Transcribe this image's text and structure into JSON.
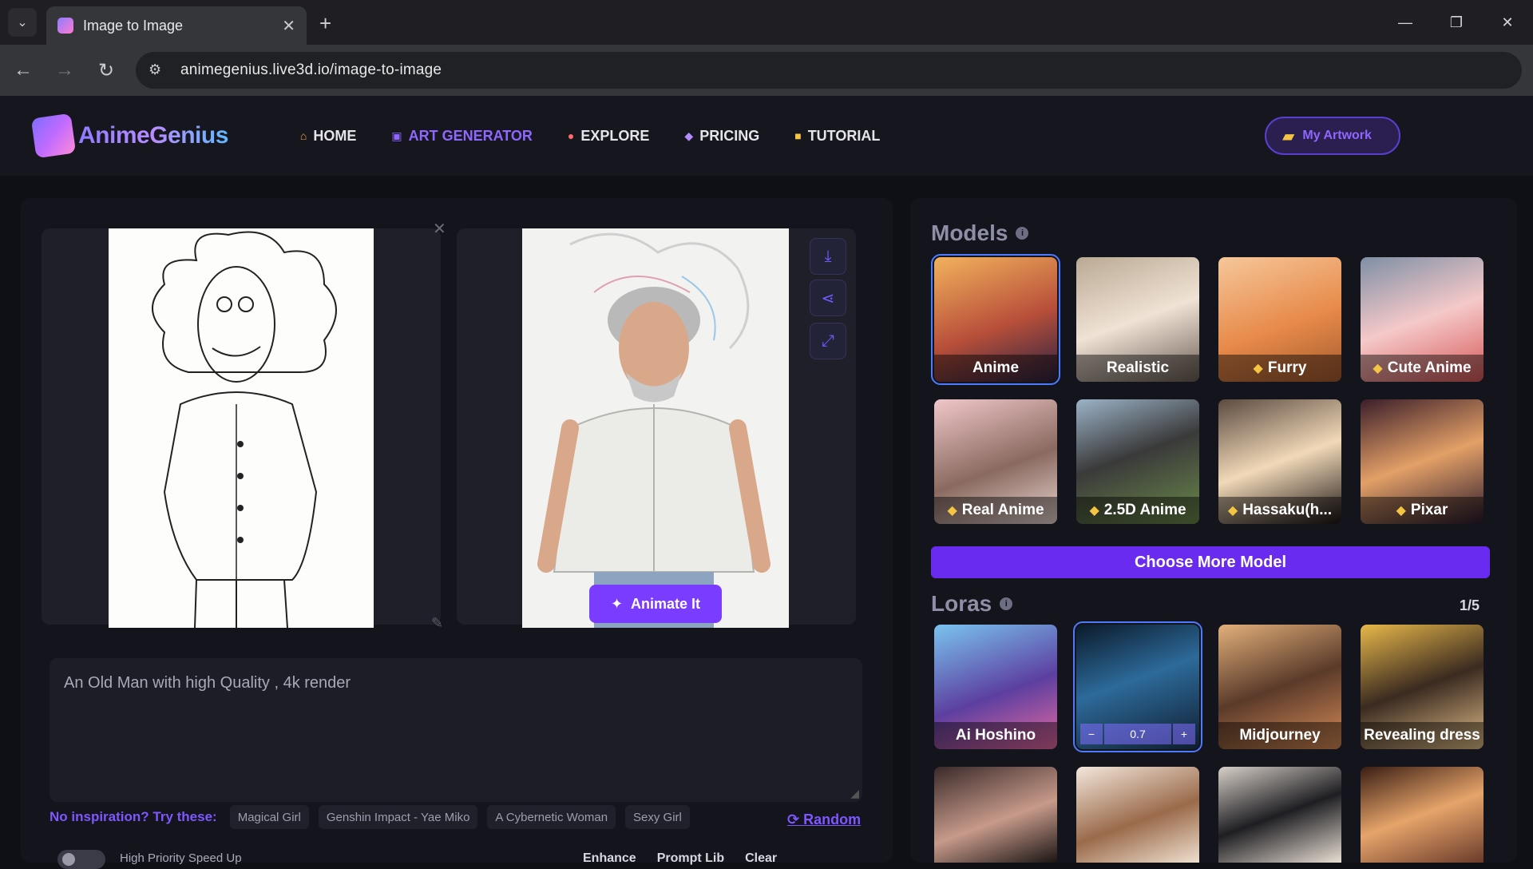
{
  "browser": {
    "tab_title": "Image to Image",
    "tab_close": "✕",
    "new_tab": "+",
    "url": "animegenius.live3d.io/image-to-image",
    "back": "←",
    "forward": "→",
    "reload": "↻",
    "window_controls": [
      "—",
      "❐",
      "✕"
    ]
  },
  "site": {
    "logo_text": "AnimeGenius",
    "menu": [
      {
        "label": "HOME",
        "icon": "home-icon",
        "active": false
      },
      {
        "label": "ART GENERATOR",
        "icon": "robot-icon",
        "active": true
      },
      {
        "label": "EXPLORE",
        "icon": "pin-icon",
        "active": false
      },
      {
        "label": "PRICING",
        "icon": "diamond-icon",
        "active": false
      },
      {
        "label": "TUTORIAL",
        "icon": "book-icon",
        "active": false
      }
    ],
    "artworks_label": "My Artwork"
  },
  "workspace": {
    "animate_label": "Animate It",
    "prompt_text": "An Old Man with high Quality , 4k render",
    "inspiration_label": "No inspiration? Try these:",
    "chips": [
      "Magical Girl",
      "Genshin Impact - Yae Miko",
      "A Cybernetic Woman",
      "Sexy Girl"
    ],
    "random_label": "Random",
    "bottom_left": "High Priority   Speed Up",
    "bottom_actions": [
      "Enhance",
      "Prompt Lib",
      "Clear"
    ]
  },
  "models": {
    "title": "Models",
    "items": [
      {
        "label": "Anime",
        "premium": false,
        "selected": true
      },
      {
        "label": "Realistic",
        "premium": false,
        "selected": false
      },
      {
        "label": "Furry",
        "premium": true,
        "selected": false
      },
      {
        "label": "Cute Anime",
        "premium": true,
        "selected": false
      },
      {
        "label": "Real Anime",
        "premium": true,
        "selected": false
      },
      {
        "label": "2.5D Anime",
        "premium": true,
        "selected": false
      },
      {
        "label": "Hassaku(h...",
        "premium": true,
        "selected": false
      },
      {
        "label": "Pixar",
        "premium": true,
        "selected": false
      }
    ],
    "choose_more": "Choose More Model"
  },
  "loras": {
    "title": "Loras",
    "count": "1/5",
    "items": [
      {
        "label": "Ai Hoshino",
        "selected": false
      },
      {
        "label": "",
        "selected": true,
        "weight": "0.7"
      },
      {
        "label": "Midjourney",
        "selected": false
      },
      {
        "label": "Revealing dress",
        "selected": false
      }
    ],
    "stepper_minus": "−",
    "stepper_plus": "+"
  },
  "colors": {
    "accent": "#7a3cff",
    "active_menu": "#8f67ff",
    "selection_border": "#4d7bff",
    "premium_gem": "#f4c542"
  }
}
